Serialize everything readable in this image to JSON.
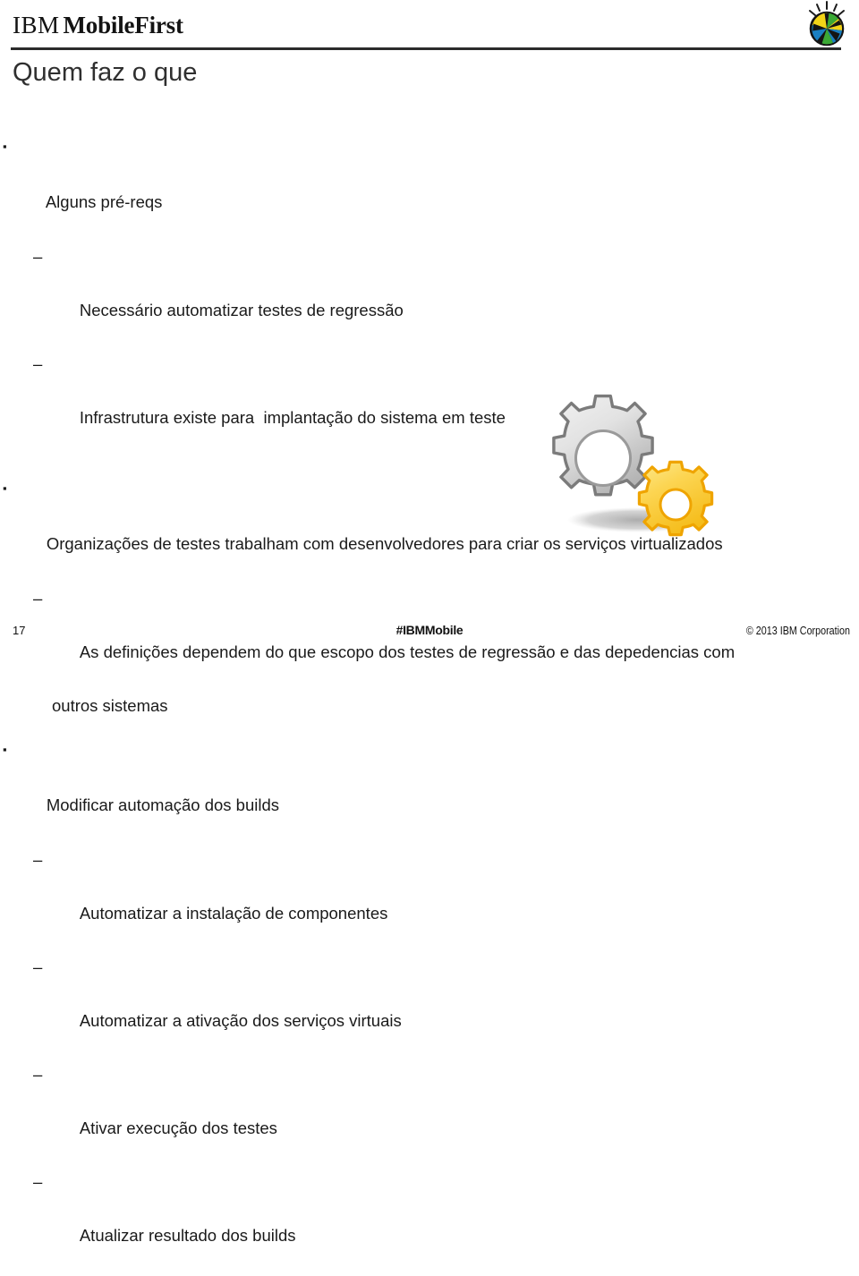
{
  "header": {
    "brand_prefix": "IBM",
    "brand_name": "MobileFirst",
    "corp_mark_icon": "ibm-mobilefirst-pinwheel-icon",
    "rule_color": "#2b2b2b"
  },
  "title": "Quem faz o que",
  "body": {
    "groups": [
      {
        "heading": "Alguns pré-reqs",
        "marker": "▪",
        "sub_marker": "–",
        "items": [
          {
            "text": "Necessário automatizar testes de regressão",
            "continuation": null
          },
          {
            "text": "Infrastrutura existe para  implantação do sistema em teste",
            "continuation": null
          }
        ]
      },
      {
        "heading": "Organizações de testes trabalham com desenvolvedores para criar os serviços virtualizados",
        "marker": "▪",
        "sub_marker": "–",
        "items": [
          {
            "text": "As definições dependem do que escopo dos testes de regressão e das depedencias com",
            "continuation": "outros sistemas"
          }
        ]
      },
      {
        "heading": "Modificar automação dos builds",
        "marker": "▪",
        "sub_marker": "–",
        "items": [
          {
            "text": "Automatizar a instalação de componentes",
            "continuation": null
          },
          {
            "text": "Automatizar a ativação dos serviços virtuais",
            "continuation": null
          },
          {
            "text": "Ativar execução dos testes",
            "continuation": null
          },
          {
            "text": "Atualizar resultado dos builds",
            "continuation": null
          }
        ]
      }
    ]
  },
  "artwork": {
    "name": "two-gears-illustration",
    "gray_gear_color": "#dcdcdc",
    "gray_gear_outline": "#7b7b7b",
    "yellow_gear_color": "#fbd24e",
    "yellow_gear_outline": "#efa400",
    "shadow_color": "#b9b9b9"
  },
  "footer": {
    "page_number": "17",
    "hashtag": "#IBMMobile",
    "copyright": "© 2013 IBM Corporation"
  }
}
